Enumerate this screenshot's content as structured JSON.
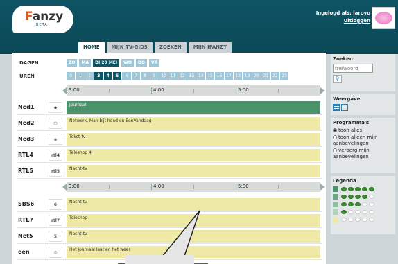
{
  "brand": {
    "name_f": "F",
    "name_rest": "anzy",
    "beta": "BETA"
  },
  "user": {
    "logged_in": "Ingelogd als: laroyo",
    "logout": "Uitloggen"
  },
  "tabs": [
    {
      "label": "HOME",
      "active": true
    },
    {
      "label": "MIJN TV-GIDS"
    },
    {
      "label": "ZOEKEN"
    },
    {
      "label": "MIJN IFANZY"
    }
  ],
  "labels": {
    "days": "DAGEN",
    "hours": "UREN"
  },
  "days": [
    {
      "label": "ZO"
    },
    {
      "label": "MA"
    },
    {
      "label": "DI 20 MEI",
      "active": true
    },
    {
      "label": "WO"
    },
    {
      "label": "DO"
    },
    {
      "label": "VR"
    }
  ],
  "hours": [
    "0",
    "1",
    "2",
    "3",
    "4",
    "5",
    "6",
    "7",
    "8",
    "9",
    "10",
    "11",
    "12",
    "13",
    "14",
    "15",
    "16",
    "17",
    "18",
    "19",
    "20",
    "21",
    "22",
    "23"
  ],
  "active_hours": [
    "3",
    "4",
    "5"
  ],
  "timeline": [
    "3:00",
    "4:00",
    "5:00"
  ],
  "channels_a": [
    {
      "name": "Ned1",
      "logo": "◆",
      "program": "Journaal",
      "highlight": true
    },
    {
      "name": "Ned2",
      "logo": "⬡",
      "program": "Netwerk, Man bijt hond en EenVandaag"
    },
    {
      "name": "Ned3",
      "logo": "◈",
      "program": "Tekst-tv"
    },
    {
      "name": "RTL4",
      "logo": "rtl4",
      "program": "Teleshop 4"
    },
    {
      "name": "RTL5",
      "logo": "rtl5",
      "program": "Nacht-tv"
    }
  ],
  "channels_b": [
    {
      "name": "SBS6",
      "logo": "6",
      "program": "Nacht-tv"
    },
    {
      "name": "RTL7",
      "logo": "rtl7",
      "program": "Teleshop"
    },
    {
      "name": "Net5",
      "logo": "5",
      "program": "Nacht-tv"
    },
    {
      "name": "een",
      "logo": "◎",
      "program": "Het journaal laat en het weer"
    }
  ],
  "sidebar": {
    "search_title": "Zoeken",
    "search_placeholder": "trefwoord",
    "view_title": "Weergave",
    "programs_title": "Programma's",
    "options": [
      {
        "label": "toon alles",
        "checked": true
      },
      {
        "label": "toon alleen mijn aanbevelingen"
      },
      {
        "label": "verberg mijn aanbevelingen"
      }
    ],
    "legend_title": "Legenda",
    "legend": [
      {
        "color": "#4a936b",
        "filled": 5
      },
      {
        "color": "#69a681",
        "filled": 4
      },
      {
        "color": "#8fbf9f",
        "filled": 3
      },
      {
        "color": "#b2d3bc",
        "filled": 1
      },
      {
        "color": "#eeeaa6",
        "filled": 0
      }
    ]
  }
}
